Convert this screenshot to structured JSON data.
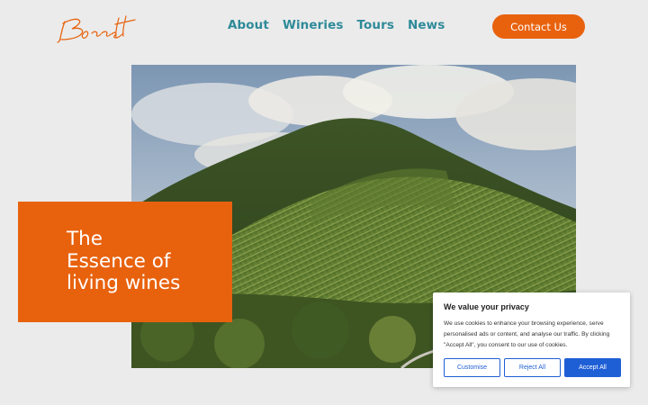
{
  "logo": {
    "text": "Borett",
    "color": "#e8620e"
  },
  "nav": {
    "items": [
      "About",
      "Wineries",
      "Tours",
      "News"
    ],
    "color": "#2e8a99"
  },
  "header": {
    "contact_label": "Contact Us"
  },
  "hero": {
    "headline": "The\nEssence of\nliving wines",
    "accent": "#e8620e"
  },
  "cookie": {
    "title": "We value your privacy",
    "body": "We use cookies to enhance your browsing experience, serve personalised ads or content, and analyse our traffic. By clicking \"Accept All\", you consent to our use of cookies.",
    "customise_label": "Customise",
    "reject_label": "Reject All",
    "accept_label": "Accept All",
    "button_color": "#1f5fd6"
  }
}
